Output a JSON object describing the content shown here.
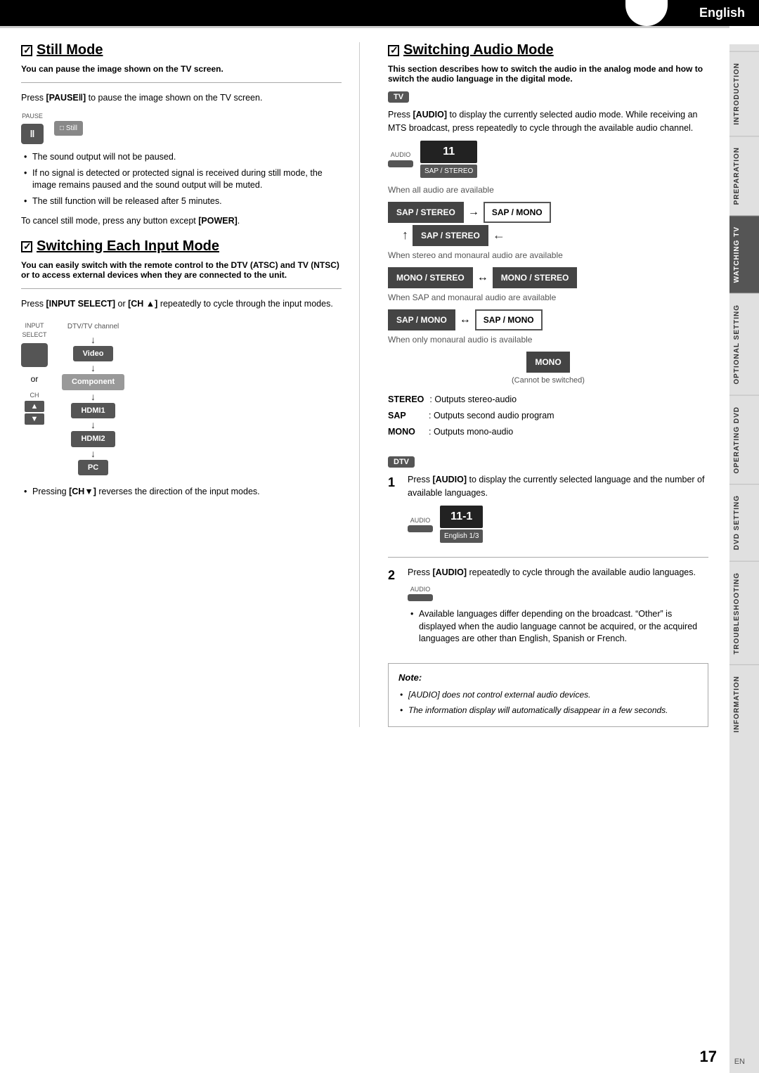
{
  "header": {
    "language": "English"
  },
  "sidebar": {
    "sections": [
      {
        "label": "INTRODUCTION"
      },
      {
        "label": "PREPARATION"
      },
      {
        "label": "WATCHING TV",
        "active": true
      },
      {
        "label": "OPTIONAL SETTING"
      },
      {
        "label": "OPERATING DVD"
      },
      {
        "label": "DVD SETTING"
      },
      {
        "label": "TROUBLESHOOTING"
      },
      {
        "label": "INFORMATION"
      }
    ]
  },
  "still_mode": {
    "title": "Still Mode",
    "subtitle": "You can pause the image shown on the TV screen.",
    "body1": "Press [PAUSE‖] to pause the image shown on the TV screen.",
    "pause_label": "PAUSE",
    "pause_symbol": "‖",
    "still_label": "□ Still",
    "bullets": [
      "The sound output will not be paused.",
      "If no signal is detected or protected signal is received during still mode, the image remains paused and the sound output will be muted.",
      "The still function will be released after 5 minutes."
    ],
    "cancel_text": "To cancel still mode, press any button except [POWER]."
  },
  "switching_audio_mode": {
    "title": "Switching Audio Mode",
    "subtitle": "This section describes how to switch the audio in the analog mode and how to switch the audio language in the digital mode.",
    "tv_badge": "TV",
    "body1": "Press [AUDIO] to display the currently selected audio mode. While receiving an MTS broadcast, press repeatedly to cycle through the available audio channel.",
    "audio_label": "AUDIO",
    "screen_value": "11",
    "screen_sub": "SAP / STEREO",
    "all_audio_label": "When all audio are available",
    "sap_stereo": "SAP / STEREO",
    "sap_mono": "SAP / MONO",
    "stereo_only": "SAP / STEREO",
    "when_stereo_mono": "When stereo and monaural audio are available",
    "mono_stereo1": "MONO / STEREO",
    "mono_stereo2": "MONO / STEREO",
    "when_sap_mono": "When SAP and monaural audio are available",
    "sap_mono1": "SAP / MONO",
    "sap_mono2": "SAP / MONO",
    "when_only_mono": "When only monaural audio is available",
    "mono_only": "MONO",
    "cannot_switch": "(Cannot be switched)",
    "legend": [
      {
        "key": "STEREO",
        "value": ": Outputs stereo-audio"
      },
      {
        "key": "SAP",
        "value": ": Outputs second audio program"
      },
      {
        "key": "MONO",
        "value": ": Outputs mono-audio"
      }
    ],
    "dtv_badge": "DTV",
    "step1_num": "1",
    "step1_text": "Press [AUDIO] to display the currently selected language and the number of available languages.",
    "step1_screen_value": "11-1",
    "step1_screen_sub": "English 1/3",
    "step2_num": "2",
    "step2_text": "Press [AUDIO] repeatedly to cycle through the available audio languages.",
    "step2_bullet": "Available languages differ depending on the broadcast. “Other” is displayed when the audio language cannot be acquired, or the acquired languages are other than English, Spanish or French.",
    "note_title": "Note:",
    "note_bullets": [
      "[AUDIO] does not control external audio devices.",
      "The information display will automatically disappear in a few seconds."
    ]
  },
  "switching_each_input": {
    "title": "Switching Each Input Mode",
    "subtitle": "You can easily switch with the remote control to the DTV (ATSC) and TV (NTSC) or to access external devices when they are connected to the unit.",
    "body1": "Press [INPUT SELECT] or [CH ▲] repeatedly to cycle through the input modes.",
    "input_label": "INPUT\nSELECT",
    "ch_label": "CH",
    "channel_header": "DTV/TV channel",
    "channels": [
      "Video",
      "Component",
      "HDMI1",
      "HDMI2",
      "PC"
    ],
    "bullet": "Pressing [CH▼] reverses the direction of the input modes."
  },
  "page": {
    "number": "17",
    "en": "EN"
  }
}
